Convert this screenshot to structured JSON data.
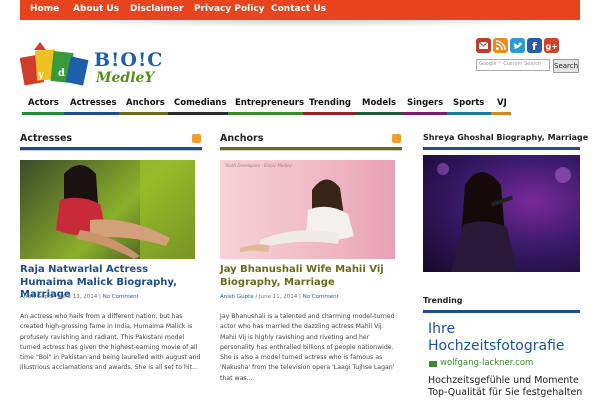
{
  "topnav": [
    "Home",
    "About Us",
    "Disclaimer",
    "Privacy Policy",
    "Contact Us"
  ],
  "logo": {
    "line1": "B!O!C",
    "line2": "MedleY"
  },
  "social_icons": [
    "email-icon",
    "rss-icon",
    "twitter-icon",
    "facebook-icon",
    "google-plus-icon"
  ],
  "search": {
    "placeholder": "Google™ Custom Search",
    "button": "Search"
  },
  "categories": [
    {
      "label": "Actors",
      "color": "#1e8a3a"
    },
    {
      "label": "Actresses",
      "color": "#1d4d8c"
    },
    {
      "label": "Anchors",
      "color": "#6b6b1e"
    },
    {
      "label": "Comedians",
      "color": "#2a2a2a"
    },
    {
      "label": "Entrepreneurs",
      "color": "#3a8a2a"
    },
    {
      "label": "Trending",
      "color": "#a01e2a"
    },
    {
      "label": "Models",
      "color": "#1e5a3a"
    },
    {
      "label": "Singers",
      "color": "#7a1e6a"
    },
    {
      "label": "Sports",
      "color": "#1e7a9a"
    },
    {
      "label": "VJ",
      "color": "#d08a1a"
    }
  ],
  "columns": [
    {
      "title": "Actresses",
      "rule_color": "#1d4d8c",
      "post": {
        "title": "Raja Natwarlal Actress Humaima Malick Biography, Marriage",
        "title_color": "#1d4d8c",
        "author": "Anish Gupta",
        "date": "June 13, 2014",
        "comments": "No Comment",
        "excerpt": "An actress who hails from a different nation, but has created high-grossing fame in India, Humaima Malick is profusely ravishing and radiant. This Pakistani model turned actress has given the highest-earning movie of all time \"Bol\" in Pakistan and being laurelled with august and illustrious acclamations and awards. She is all set to hit..."
      }
    },
    {
      "title": "Anchors",
      "rule_color": "#6b6b1e",
      "post": {
        "title": "Jay Bhanushali Wife Mahii Vij Biography, Marriage",
        "title_color": "#6b6b1e",
        "author": "Anish Gupta",
        "date": "June 11, 2014",
        "comments": "No Comment",
        "excerpt": "Jay Bhanushali is a talented and charming model-turned actor who has married the dazzling actress Mahii Vij. Mahii Vij is highly ravishing and riveting and her personality has enthralled billions of people nationwide. She is also a model turned actress who is famous as 'Nakusha' from the television opera 'Laagi Tujhse Lagan' that was..."
      }
    }
  ],
  "photo_watermark": "Youth Developers - Biopic Medley",
  "sidebar": {
    "featured_title": "Shreya Ghoshal Biography, Marriage",
    "trending_title": "Trending",
    "ad": {
      "title": "Ihre Hochzeitsfotografie",
      "url": "wolfgang-lackner.com",
      "body": "Hochzeitsgefühle und Momente Top-Qualität für Sie festgehalten"
    }
  },
  "meta_separator": " / ",
  "date_separator": " | "
}
